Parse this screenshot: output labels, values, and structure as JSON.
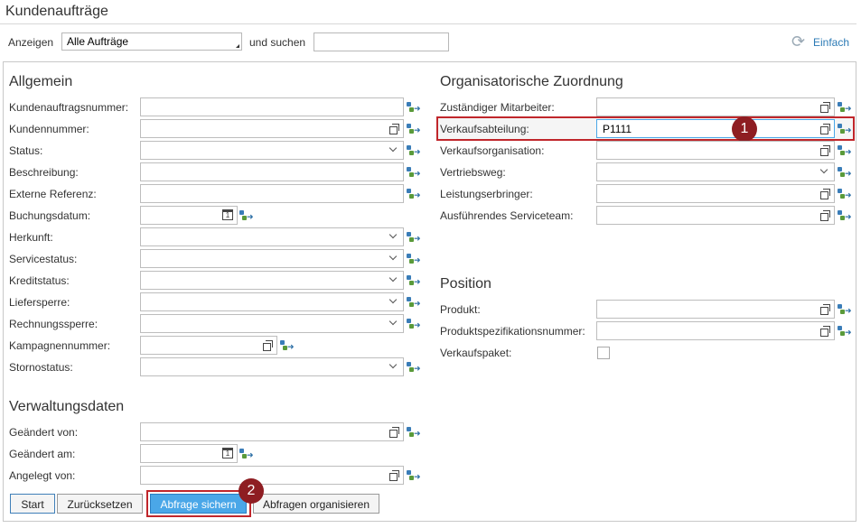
{
  "page": {
    "title": "Kundenaufträge",
    "show_label": "Anzeigen",
    "show_value": "Alle Aufträge",
    "search_label": "und suchen",
    "search_value": "",
    "simple_link": "Einfach"
  },
  "general": {
    "heading": "Allgemein",
    "fields": [
      {
        "label": "Kundenauftragsnummer:",
        "value": ""
      },
      {
        "label": "Kundennummer:",
        "value": ""
      },
      {
        "label": "Status:",
        "value": ""
      },
      {
        "label": "Beschreibung:",
        "value": ""
      },
      {
        "label": "Externe Referenz:",
        "value": ""
      },
      {
        "label": "Buchungsdatum:",
        "value": ""
      },
      {
        "label": "Herkunft:",
        "value": ""
      },
      {
        "label": "Servicestatus:",
        "value": ""
      },
      {
        "label": "Kreditstatus:",
        "value": ""
      },
      {
        "label": "Liefersperre:",
        "value": ""
      },
      {
        "label": "Rechnungssperre:",
        "value": ""
      },
      {
        "label": "Kampagnennummer:",
        "value": ""
      },
      {
        "label": "Stornostatus:",
        "value": ""
      }
    ]
  },
  "admin": {
    "heading": "Verwaltungsdaten",
    "fields": [
      {
        "label": "Geändert von:",
        "value": ""
      },
      {
        "label": "Geändert am:",
        "value": ""
      },
      {
        "label": "Angelegt von:",
        "value": ""
      }
    ]
  },
  "org": {
    "heading": "Organisatorische Zuordnung",
    "fields": [
      {
        "label": "Zuständiger Mitarbeiter:",
        "value": ""
      },
      {
        "label": "Verkaufsabteilung:",
        "value": "P1111"
      },
      {
        "label": "Verkaufsorganisation:",
        "value": ""
      },
      {
        "label": "Vertriebsweg:",
        "value": ""
      },
      {
        "label": "Leistungserbringer:",
        "value": ""
      },
      {
        "label": "Ausführendes Serviceteam:",
        "value": ""
      }
    ]
  },
  "position": {
    "heading": "Position",
    "fields": [
      {
        "label": "Produkt:",
        "value": ""
      },
      {
        "label": "Produktspezifikationsnummer:",
        "value": ""
      },
      {
        "label": "Verkaufspaket:",
        "value": ""
      }
    ]
  },
  "buttons": {
    "start": "Start",
    "reset": "Zurücksetzen",
    "save_query": "Abfrage sichern",
    "organize": "Abfragen organisieren"
  },
  "badges": {
    "one": "1",
    "two": "2"
  },
  "icons": {
    "value_help": "copy-icon",
    "multi_select": "multi-select-icon",
    "dropdown": "chevron-down-icon",
    "calendar": "calendar-icon",
    "refresh": "refresh-icon"
  },
  "colors": {
    "accent": "#4aa7e8",
    "highlight": "#c0262b",
    "badge": "#8e1d22",
    "link": "#2b7ab5"
  }
}
